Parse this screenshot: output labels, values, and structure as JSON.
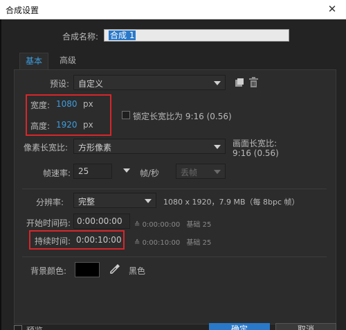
{
  "window": {
    "title": "合成设置",
    "close": "✕"
  },
  "comp_name": {
    "label": "合成名称:",
    "value": "合成 1"
  },
  "tabs": [
    {
      "label": "基本",
      "active": true
    },
    {
      "label": "高级",
      "active": false
    }
  ],
  "preset": {
    "label": "预设:",
    "value": "自定义"
  },
  "width": {
    "label": "宽度:",
    "value": "1080",
    "unit": "px"
  },
  "height": {
    "label": "高度:",
    "value": "1920",
    "unit": "px"
  },
  "lock_aspect": {
    "label": "锁定长宽比为 9:16 (0.56)",
    "checked": false
  },
  "pixel_aspect": {
    "label": "像素长宽比:",
    "value": "方形像素"
  },
  "frame_aspect": {
    "label": "画面长宽比:",
    "value": "9:16 (0.56)"
  },
  "frame_rate": {
    "label": "帧速率:",
    "value": "25",
    "unit": "帧/秒",
    "drop_frame": "丢帧"
  },
  "resolution": {
    "label": "分辨率:",
    "value": "完整",
    "info": "1080 x 1920，7.9 MB（每 8bpc 帧）"
  },
  "start_timecode": {
    "label": "开始时间码:",
    "value": "0:00:00:00",
    "info_time": "0:00:00:00",
    "info_base": "基础 25"
  },
  "duration": {
    "label": "持续时间:",
    "value": "0:00:10:00",
    "info_time": "0:00:10:00",
    "info_base": "基础 25"
  },
  "background_color": {
    "label": "背景颜色:",
    "color": "#000000",
    "name": "黑色"
  },
  "footer": {
    "preview": "预览",
    "ok": "确定",
    "cancel": "取消"
  },
  "colors": {
    "accent": "#3d9ee0",
    "highlight": "#d8262b",
    "dialog_bg": "#232323",
    "panel_bg": "#2c2c2c"
  }
}
